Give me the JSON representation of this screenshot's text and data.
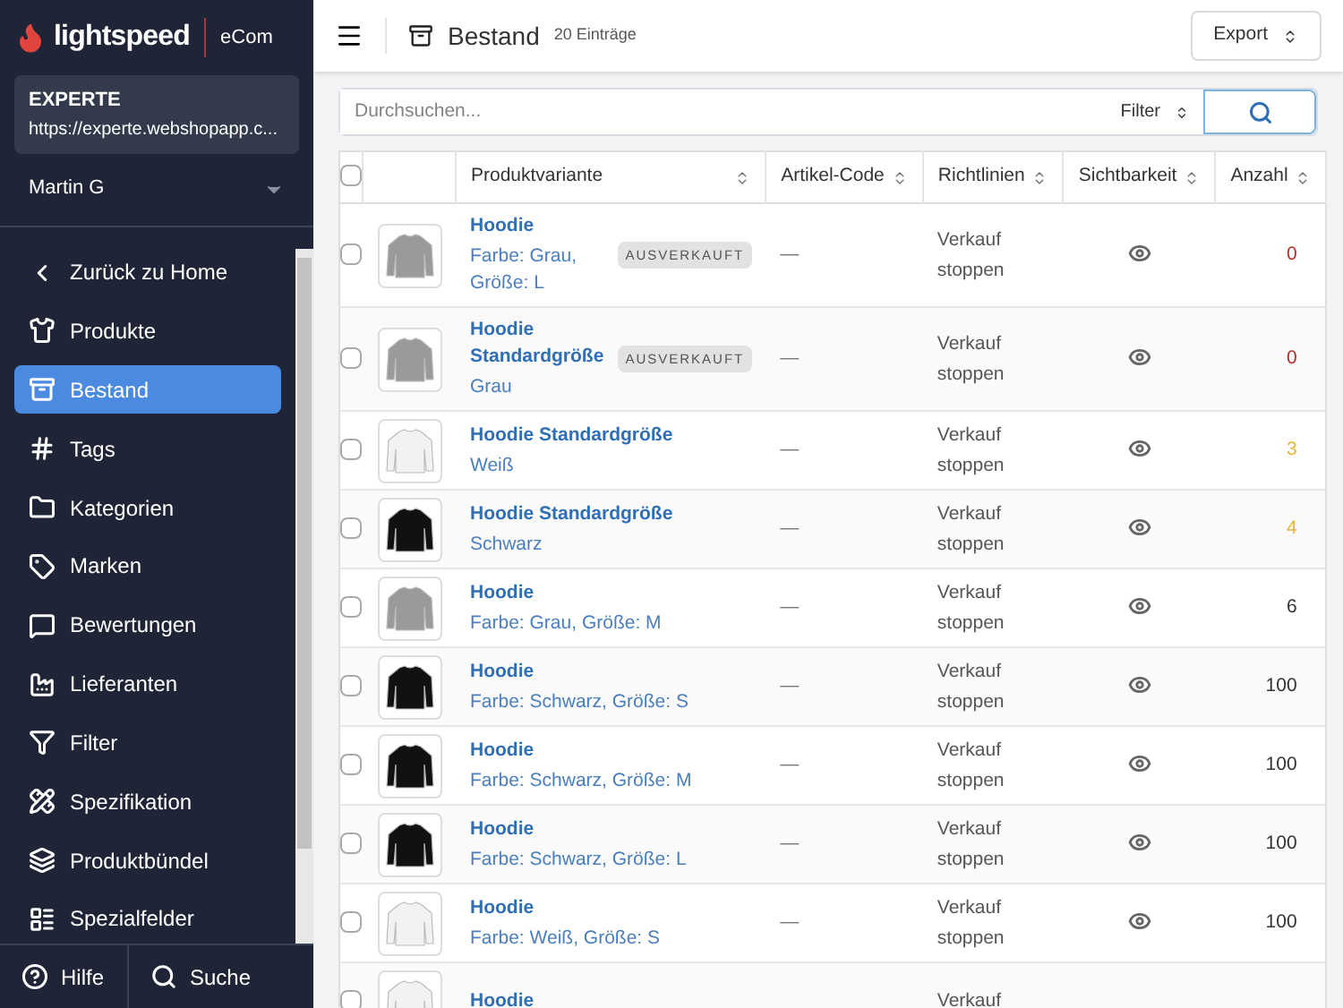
{
  "brand": {
    "name": "lightspeed",
    "product": "eCom"
  },
  "shop": {
    "name": "EXPERTE",
    "url": "https://experte.webshopapp.c..."
  },
  "user": {
    "name": "Martin G"
  },
  "sidebar": {
    "items": [
      {
        "label": "Zurück zu Home",
        "selected": false
      },
      {
        "label": "Produkte",
        "selected": false
      },
      {
        "label": "Bestand",
        "selected": true
      },
      {
        "label": "Tags",
        "selected": false
      },
      {
        "label": "Kategorien",
        "selected": false
      },
      {
        "label": "Marken",
        "selected": false
      },
      {
        "label": "Bewertungen",
        "selected": false
      },
      {
        "label": "Lieferanten",
        "selected": false
      },
      {
        "label": "Filter",
        "selected": false
      },
      {
        "label": "Spezifikation",
        "selected": false
      },
      {
        "label": "Produktbündel",
        "selected": false
      },
      {
        "label": "Spezialfelder",
        "selected": false
      }
    ],
    "footer": [
      "Hilfe",
      "Suche"
    ]
  },
  "header": {
    "title": "Bestand",
    "count": "20 Einträge",
    "export": "Export"
  },
  "search": {
    "placeholder": "Durchsuchen...",
    "filter": "Filter"
  },
  "table": {
    "all_checked": false,
    "columns": [
      "Produktvariante",
      "Artikel-Code",
      "Richtlinien",
      "Sichtbarkeit",
      "Anzahl"
    ],
    "rows": [
      {
        "checked": false,
        "color": "#9a9a9a",
        "name": "Hoodie",
        "variant": "Farbe: Grau, Größe: L",
        "badge": "AUSVERKAUFT",
        "code": "—",
        "policy": "Verkauf stoppen",
        "quantity": {
          "text": "0",
          "color": "#b0302b"
        }
      },
      {
        "checked": false,
        "color": "#9a9a9a",
        "name": "Hoodie Standardgröße",
        "variant": "Grau",
        "badge": "AUSVERKAUFT",
        "code": "—",
        "policy": "Verkauf stoppen",
        "quantity": {
          "text": "0",
          "color": "#b0302b"
        }
      },
      {
        "checked": false,
        "color": "#f2f2f2",
        "name": "Hoodie Standardgröße",
        "variant": "Weiß",
        "code": "—",
        "policy": "Verkauf stoppen",
        "quantity": {
          "text": "3",
          "color": "#e7b53a"
        }
      },
      {
        "checked": false,
        "color": "#111111",
        "name": "Hoodie Standardgröße",
        "variant": "Schwarz",
        "code": "—",
        "policy": "Verkauf stoppen",
        "quantity": {
          "text": "4",
          "color": "#e7b53a"
        }
      },
      {
        "checked": false,
        "color": "#9a9a9a",
        "name": "Hoodie",
        "variant": "Farbe: Grau, Größe: M",
        "code": "—",
        "policy": "Verkauf stoppen",
        "quantity": {
          "text": "6",
          "color": "#333333"
        }
      },
      {
        "checked": false,
        "color": "#111111",
        "name": "Hoodie",
        "variant": "Farbe: Schwarz, Größe: S",
        "code": "—",
        "policy": "Verkauf stoppen",
        "quantity": {
          "text": "100",
          "color": "#333333"
        }
      },
      {
        "checked": false,
        "color": "#111111",
        "name": "Hoodie",
        "variant": "Farbe: Schwarz, Größe: M",
        "code": "—",
        "policy": "Verkauf stoppen",
        "quantity": {
          "text": "100",
          "color": "#333333"
        }
      },
      {
        "checked": false,
        "color": "#111111",
        "name": "Hoodie",
        "variant": "Farbe: Schwarz, Größe: L",
        "code": "—",
        "policy": "Verkauf stoppen",
        "quantity": {
          "text": "100",
          "color": "#333333"
        }
      },
      {
        "checked": false,
        "color": "#f2f2f2",
        "name": "Hoodie",
        "variant": "Farbe: Weiß, Größe: S",
        "code": "—",
        "policy": "Verkauf stoppen",
        "quantity": {
          "text": "100",
          "color": "#333333"
        }
      },
      {
        "checked": false,
        "color": "#f2f2f2",
        "name": "Hoodie",
        "policy": "Verkauf"
      }
    ]
  }
}
